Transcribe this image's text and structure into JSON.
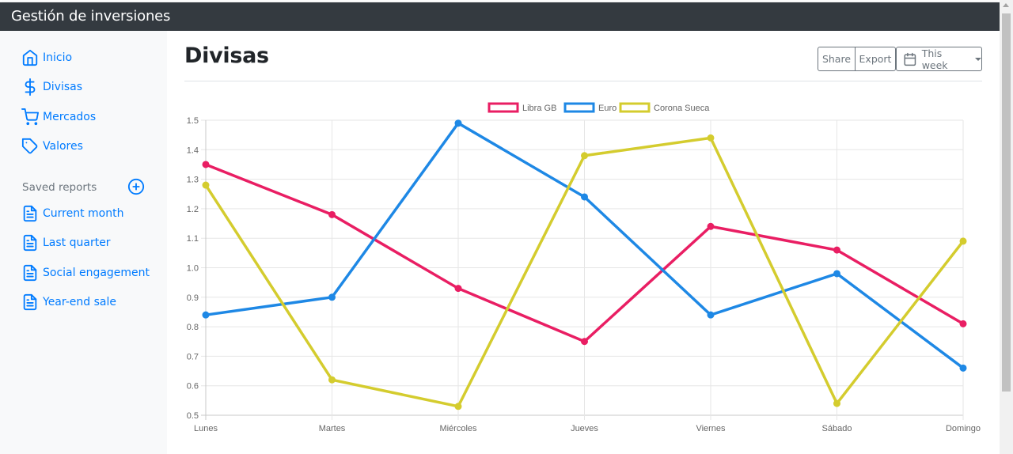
{
  "app": {
    "brand": "Gestión de inversiones"
  },
  "sidebar": {
    "items": [
      {
        "label": "Inicio",
        "icon": "home-icon"
      },
      {
        "label": "Divisas",
        "icon": "dollar-icon"
      },
      {
        "label": "Mercados",
        "icon": "cart-icon"
      },
      {
        "label": "Valores",
        "icon": "tag-icon"
      }
    ],
    "saved_heading": "Saved reports",
    "reports": [
      {
        "label": "Current month",
        "icon": "file-text-icon"
      },
      {
        "label": "Last quarter",
        "icon": "file-text-icon"
      },
      {
        "label": "Social engagement",
        "icon": "file-text-icon"
      },
      {
        "label": "Year-end sale",
        "icon": "file-text-icon"
      }
    ]
  },
  "main": {
    "title": "Divisas",
    "toolbar": {
      "share": "Share",
      "export": "Export",
      "period": "This week"
    }
  },
  "colors": {
    "navbar": "#343a40",
    "link": "#007bff",
    "libra": "#e91e63",
    "euro": "#1e88e5",
    "corona": "#d4cc2e"
  },
  "chart_data": {
    "type": "line",
    "categories": [
      "Lunes",
      "Martes",
      "Miércoles",
      "Jueves",
      "Viernes",
      "Sábado",
      "Domingo"
    ],
    "series": [
      {
        "name": "Libra GB",
        "color": "#e91e63",
        "values": [
          1.35,
          1.18,
          0.93,
          0.75,
          1.14,
          1.06,
          0.81
        ]
      },
      {
        "name": "Euro",
        "color": "#1e88e5",
        "values": [
          0.84,
          0.9,
          1.49,
          1.24,
          0.84,
          0.98,
          0.66
        ]
      },
      {
        "name": "Corona Sueca",
        "color": "#d4cc2e",
        "values": [
          1.28,
          0.62,
          0.53,
          1.38,
          1.44,
          0.54,
          1.09
        ]
      }
    ],
    "ylim": [
      0.5,
      1.5
    ],
    "yticks": [
      "0.5",
      "0.6",
      "0.7",
      "0.8",
      "0.9",
      "1.0",
      "1.1",
      "1.2",
      "1.3",
      "1.4",
      "1.5"
    ],
    "grid": true,
    "legend": "top"
  }
}
